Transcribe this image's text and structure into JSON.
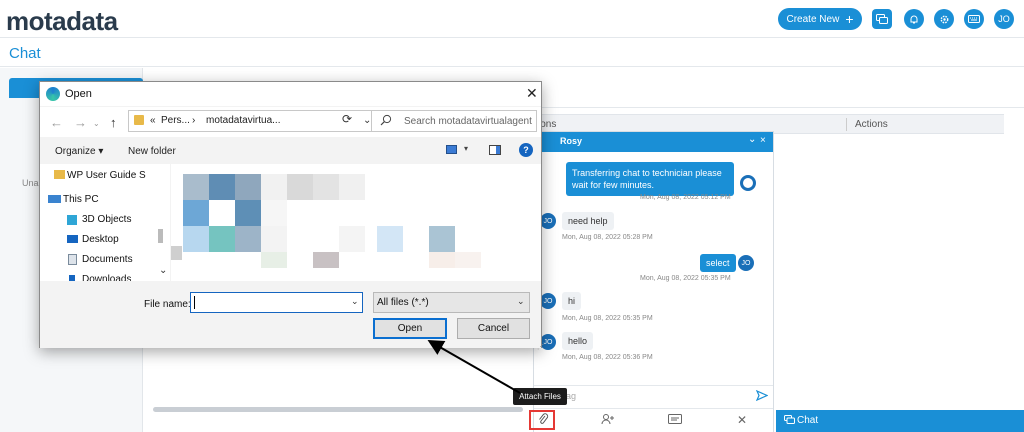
{
  "header": {
    "logo_text": "motadata",
    "create_label": "Create New",
    "create_icon": "+",
    "user_initials": "JO",
    "brand_color": "#1a8fd6"
  },
  "page": {
    "title": "Chat",
    "left_label": "Una",
    "table_header_1": "ions",
    "table_header_2": "Actions"
  },
  "chat": {
    "name": "Rosy",
    "minimize": "⌄",
    "close": "×",
    "messages": [
      {
        "dir": "out",
        "text": "Transferring chat to technician please wait for few minutes.",
        "time": "Mon, Aug 08, 2022 05:12 PM"
      },
      {
        "dir": "in",
        "text": "need help",
        "time": "Mon, Aug 08, 2022 05:28 PM",
        "avatar": "JO"
      },
      {
        "dir": "out",
        "text": "select",
        "time": "Mon, Aug 08, 2022 05:35 PM",
        "avatar": "JO"
      },
      {
        "dir": "in",
        "text": "hi",
        "time": "Mon, Aug 08, 2022 05:35 PM",
        "avatar": "JO"
      },
      {
        "dir": "in",
        "text": "hello",
        "time": "Mon, Aug 08, 2022 05:36 PM",
        "avatar": "JO"
      }
    ],
    "input_placeholder": "ag",
    "tooltip": "Attach Files",
    "tab_label": "Chat"
  },
  "dialog": {
    "title": "Open",
    "path_prefix": "«",
    "path_part1": "Pers...",
    "path_sep": "›",
    "path_part2": "motadatavirtua...",
    "search_placeholder": "Search motadatavirtualagent",
    "organize_label": "Organize ▾",
    "new_folder_label": "New folder",
    "nav_items": [
      {
        "label": "WP User Guide S",
        "icon": "folder-icon"
      },
      {
        "label": "This PC",
        "icon": "computer-icon"
      },
      {
        "label": "3D Objects",
        "icon": "cube-icon"
      },
      {
        "label": "Desktop",
        "icon": "desktop-icon"
      },
      {
        "label": "Documents",
        "icon": "document-icon"
      },
      {
        "label": "Downloads",
        "icon": "download-icon"
      }
    ],
    "file_name_label": "File name:",
    "file_name_value": "",
    "file_type_value": "All files (*.*)",
    "open_label": "Open",
    "cancel_label": "Cancel"
  }
}
